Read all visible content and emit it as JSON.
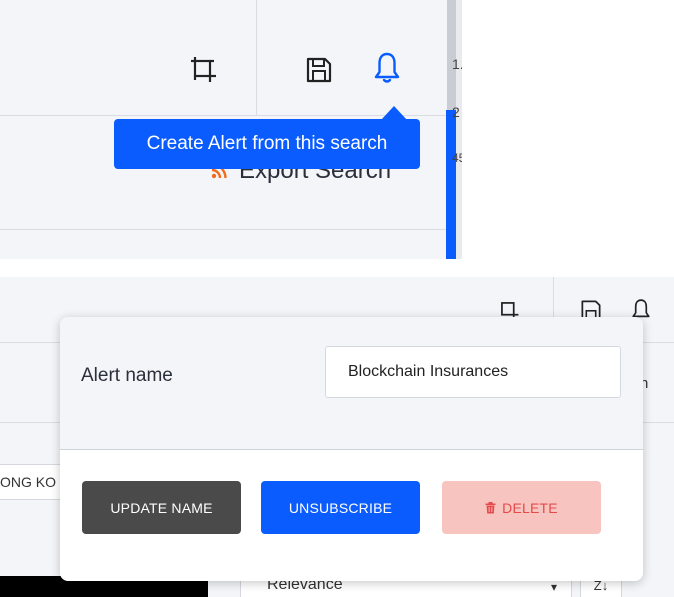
{
  "top": {
    "tooltip_text": "Create Alert from this search",
    "export_label": "Export Search",
    "edge_text_1": "1.",
    "edge_text_2": "2",
    "edge_text_3": "45"
  },
  "bottom": {
    "partial_field_text": "ONG KO",
    "right_partial_text": "h",
    "sort_select_value": "Relevance",
    "sort_direction_label": "Z↓",
    "alert_popup": {
      "name_label": "Alert name",
      "name_value": "Blockchain Insurances",
      "update_button": "UPDATE NAME",
      "unsubscribe_button": "UNSUBSCRIBE",
      "delete_button": "DELETE"
    }
  },
  "colors": {
    "accent_blue": "#0a5cff",
    "dark_button": "#4a4a4a",
    "danger_bg": "#f8c4c0",
    "danger_text": "#e34b4b",
    "rss_orange": "#f26b1d"
  }
}
